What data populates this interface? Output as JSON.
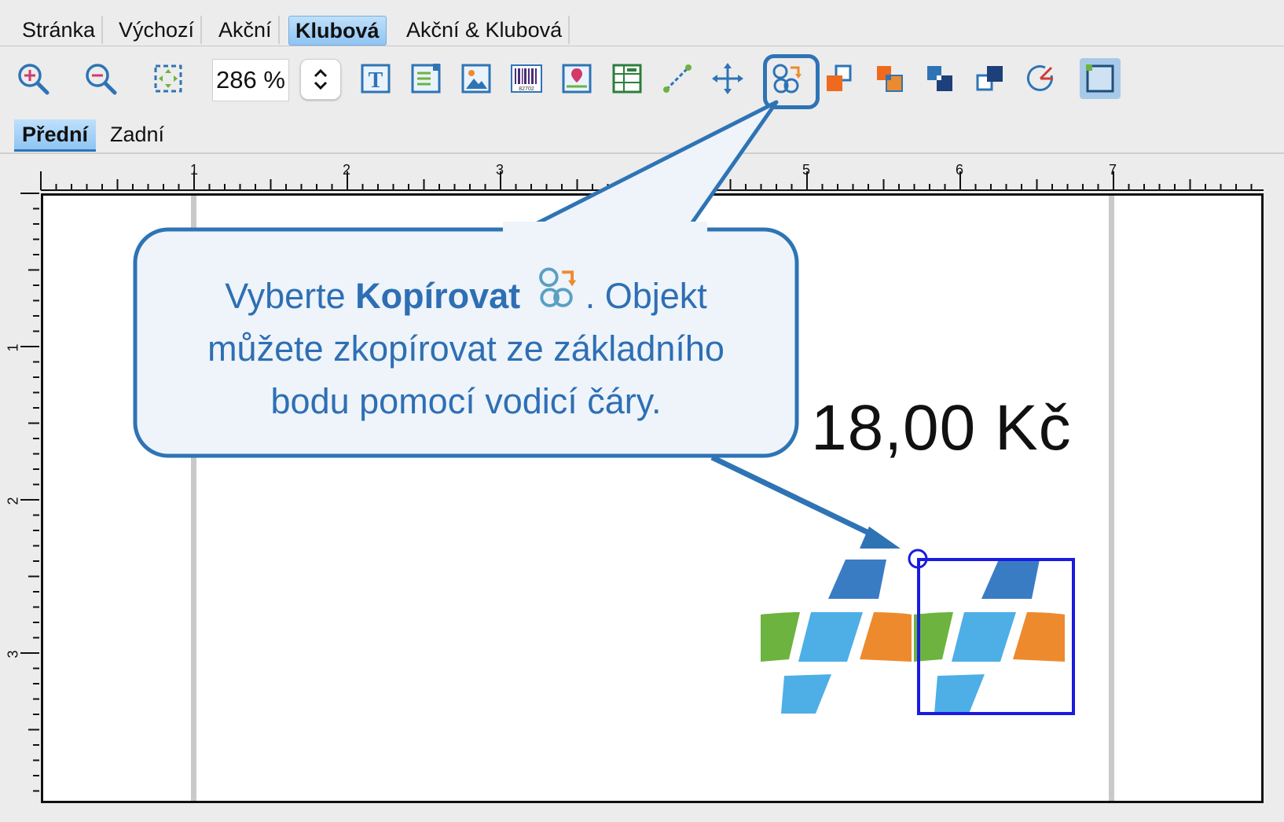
{
  "tabs": [
    {
      "label": "Stránka",
      "active": false
    },
    {
      "label": "Výchozí",
      "active": false
    },
    {
      "label": "Akční",
      "active": false
    },
    {
      "label": "Klubová",
      "active": true
    },
    {
      "label": "Akční & Klubová",
      "active": false
    }
  ],
  "toolbar": {
    "zoom_value": "286 %",
    "icons": [
      "zoom-in-icon",
      "zoom-out-icon",
      "fit-to-window-icon",
      "text-object-icon",
      "text-list-icon",
      "image-icon",
      "barcode-icon",
      "image-map-icon",
      "table-icon",
      "line-icon",
      "move-icon",
      "copy-icon",
      "bring-to-front-icon",
      "bring-forward-icon",
      "send-backward-icon",
      "send-to-back-icon",
      "rotate-icon",
      "frame-icon"
    ],
    "highlighted": "copy-icon"
  },
  "side_tabs": [
    {
      "label": "Přední",
      "active": true
    },
    {
      "label": "Zadní",
      "active": false
    }
  ],
  "ruler": {
    "horizontal_labels": [
      "1",
      "2",
      "3",
      "5",
      "6",
      "7"
    ],
    "vertical_labels": [
      "1",
      "2",
      "3"
    ]
  },
  "canvas": {
    "price_text": "18,00 Kč"
  },
  "callout": {
    "text_before": "Vyberte ",
    "bold": "Kopírovat",
    "text_after_icon": ". Objekt",
    "line2": "můžete zkopírovat ze základního",
    "line3": "bodu pomocí vodicí čáry."
  },
  "colors": {
    "callout_border": "#2e74b5",
    "callout_fill": "#eef4fa",
    "callout_text": "#2e6fb4",
    "selection": "#1a1ae0",
    "logo_dark_blue": "#3a7cc4",
    "logo_light_blue": "#4eaee6",
    "logo_green": "#6db33f",
    "logo_orange": "#ee8a2e"
  }
}
